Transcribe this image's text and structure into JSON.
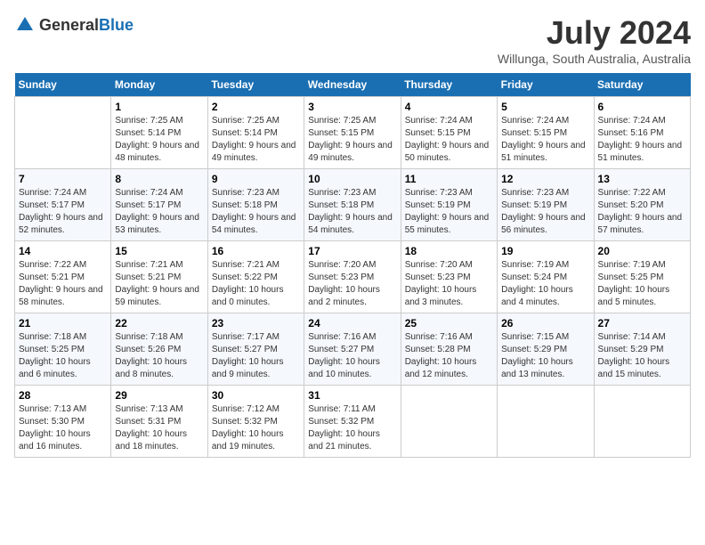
{
  "header": {
    "logo_general": "General",
    "logo_blue": "Blue",
    "month_title": "July 2024",
    "location": "Willunga, South Australia, Australia"
  },
  "days_of_week": [
    "Sunday",
    "Monday",
    "Tuesday",
    "Wednesday",
    "Thursday",
    "Friday",
    "Saturday"
  ],
  "weeks": [
    [
      {
        "day": "",
        "sunrise": "",
        "sunset": "",
        "daylight": ""
      },
      {
        "day": "1",
        "sunrise": "Sunrise: 7:25 AM",
        "sunset": "Sunset: 5:14 PM",
        "daylight": "Daylight: 9 hours and 48 minutes."
      },
      {
        "day": "2",
        "sunrise": "Sunrise: 7:25 AM",
        "sunset": "Sunset: 5:14 PM",
        "daylight": "Daylight: 9 hours and 49 minutes."
      },
      {
        "day": "3",
        "sunrise": "Sunrise: 7:25 AM",
        "sunset": "Sunset: 5:15 PM",
        "daylight": "Daylight: 9 hours and 49 minutes."
      },
      {
        "day": "4",
        "sunrise": "Sunrise: 7:24 AM",
        "sunset": "Sunset: 5:15 PM",
        "daylight": "Daylight: 9 hours and 50 minutes."
      },
      {
        "day": "5",
        "sunrise": "Sunrise: 7:24 AM",
        "sunset": "Sunset: 5:15 PM",
        "daylight": "Daylight: 9 hours and 51 minutes."
      },
      {
        "day": "6",
        "sunrise": "Sunrise: 7:24 AM",
        "sunset": "Sunset: 5:16 PM",
        "daylight": "Daylight: 9 hours and 51 minutes."
      }
    ],
    [
      {
        "day": "7",
        "sunrise": "Sunrise: 7:24 AM",
        "sunset": "Sunset: 5:17 PM",
        "daylight": "Daylight: 9 hours and 52 minutes."
      },
      {
        "day": "8",
        "sunrise": "Sunrise: 7:24 AM",
        "sunset": "Sunset: 5:17 PM",
        "daylight": "Daylight: 9 hours and 53 minutes."
      },
      {
        "day": "9",
        "sunrise": "Sunrise: 7:23 AM",
        "sunset": "Sunset: 5:18 PM",
        "daylight": "Daylight: 9 hours and 54 minutes."
      },
      {
        "day": "10",
        "sunrise": "Sunrise: 7:23 AM",
        "sunset": "Sunset: 5:18 PM",
        "daylight": "Daylight: 9 hours and 54 minutes."
      },
      {
        "day": "11",
        "sunrise": "Sunrise: 7:23 AM",
        "sunset": "Sunset: 5:19 PM",
        "daylight": "Daylight: 9 hours and 55 minutes."
      },
      {
        "day": "12",
        "sunrise": "Sunrise: 7:23 AM",
        "sunset": "Sunset: 5:19 PM",
        "daylight": "Daylight: 9 hours and 56 minutes."
      },
      {
        "day": "13",
        "sunrise": "Sunrise: 7:22 AM",
        "sunset": "Sunset: 5:20 PM",
        "daylight": "Daylight: 9 hours and 57 minutes."
      }
    ],
    [
      {
        "day": "14",
        "sunrise": "Sunrise: 7:22 AM",
        "sunset": "Sunset: 5:21 PM",
        "daylight": "Daylight: 9 hours and 58 minutes."
      },
      {
        "day": "15",
        "sunrise": "Sunrise: 7:21 AM",
        "sunset": "Sunset: 5:21 PM",
        "daylight": "Daylight: 9 hours and 59 minutes."
      },
      {
        "day": "16",
        "sunrise": "Sunrise: 7:21 AM",
        "sunset": "Sunset: 5:22 PM",
        "daylight": "Daylight: 10 hours and 0 minutes."
      },
      {
        "day": "17",
        "sunrise": "Sunrise: 7:20 AM",
        "sunset": "Sunset: 5:23 PM",
        "daylight": "Daylight: 10 hours and 2 minutes."
      },
      {
        "day": "18",
        "sunrise": "Sunrise: 7:20 AM",
        "sunset": "Sunset: 5:23 PM",
        "daylight": "Daylight: 10 hours and 3 minutes."
      },
      {
        "day": "19",
        "sunrise": "Sunrise: 7:19 AM",
        "sunset": "Sunset: 5:24 PM",
        "daylight": "Daylight: 10 hours and 4 minutes."
      },
      {
        "day": "20",
        "sunrise": "Sunrise: 7:19 AM",
        "sunset": "Sunset: 5:25 PM",
        "daylight": "Daylight: 10 hours and 5 minutes."
      }
    ],
    [
      {
        "day": "21",
        "sunrise": "Sunrise: 7:18 AM",
        "sunset": "Sunset: 5:25 PM",
        "daylight": "Daylight: 10 hours and 6 minutes."
      },
      {
        "day": "22",
        "sunrise": "Sunrise: 7:18 AM",
        "sunset": "Sunset: 5:26 PM",
        "daylight": "Daylight: 10 hours and 8 minutes."
      },
      {
        "day": "23",
        "sunrise": "Sunrise: 7:17 AM",
        "sunset": "Sunset: 5:27 PM",
        "daylight": "Daylight: 10 hours and 9 minutes."
      },
      {
        "day": "24",
        "sunrise": "Sunrise: 7:16 AM",
        "sunset": "Sunset: 5:27 PM",
        "daylight": "Daylight: 10 hours and 10 minutes."
      },
      {
        "day": "25",
        "sunrise": "Sunrise: 7:16 AM",
        "sunset": "Sunset: 5:28 PM",
        "daylight": "Daylight: 10 hours and 12 minutes."
      },
      {
        "day": "26",
        "sunrise": "Sunrise: 7:15 AM",
        "sunset": "Sunset: 5:29 PM",
        "daylight": "Daylight: 10 hours and 13 minutes."
      },
      {
        "day": "27",
        "sunrise": "Sunrise: 7:14 AM",
        "sunset": "Sunset: 5:29 PM",
        "daylight": "Daylight: 10 hours and 15 minutes."
      }
    ],
    [
      {
        "day": "28",
        "sunrise": "Sunrise: 7:13 AM",
        "sunset": "Sunset: 5:30 PM",
        "daylight": "Daylight: 10 hours and 16 minutes."
      },
      {
        "day": "29",
        "sunrise": "Sunrise: 7:13 AM",
        "sunset": "Sunset: 5:31 PM",
        "daylight": "Daylight: 10 hours and 18 minutes."
      },
      {
        "day": "30",
        "sunrise": "Sunrise: 7:12 AM",
        "sunset": "Sunset: 5:32 PM",
        "daylight": "Daylight: 10 hours and 19 minutes."
      },
      {
        "day": "31",
        "sunrise": "Sunrise: 7:11 AM",
        "sunset": "Sunset: 5:32 PM",
        "daylight": "Daylight: 10 hours and 21 minutes."
      },
      {
        "day": "",
        "sunrise": "",
        "sunset": "",
        "daylight": ""
      },
      {
        "day": "",
        "sunrise": "",
        "sunset": "",
        "daylight": ""
      },
      {
        "day": "",
        "sunrise": "",
        "sunset": "",
        "daylight": ""
      }
    ]
  ]
}
